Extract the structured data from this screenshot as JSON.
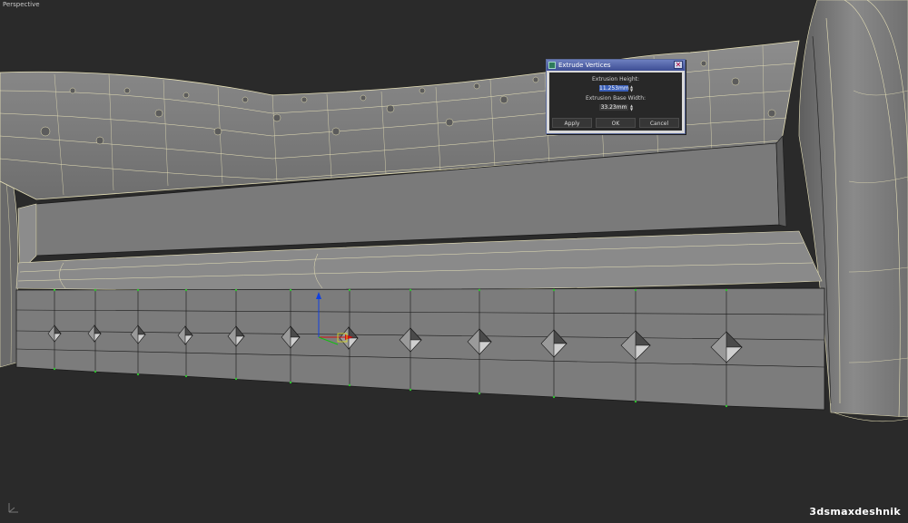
{
  "viewport": {
    "label": "Perspective"
  },
  "watermark": {
    "text": "3dsmaxdeshnik"
  },
  "dialog": {
    "title": "Extrude Vertices",
    "close_icon": "close-icon",
    "extrusion_height_label": "Extrusion Height:",
    "extrusion_height_value": "11.253mm",
    "extrusion_base_width_label": "Extrusion Base Width:",
    "extrusion_base_width_value": "33.23mm",
    "apply_label": "Apply",
    "ok_label": "OK",
    "cancel_label": "Cancel"
  },
  "colors": {
    "viewport_bg": "#2a2a2a",
    "mesh_gray": "#8a8a8a",
    "wire_yellow": "#e8e2b8",
    "wire_dark": "#1a1a1a",
    "dialog_title": "#4f60a3",
    "spinner_selected": "#3a5fb8",
    "gizmo_red": "#d01010",
    "gizmo_green": "#10c010",
    "gizmo_blue": "#1040e0",
    "vertex_green": "#30c030"
  }
}
